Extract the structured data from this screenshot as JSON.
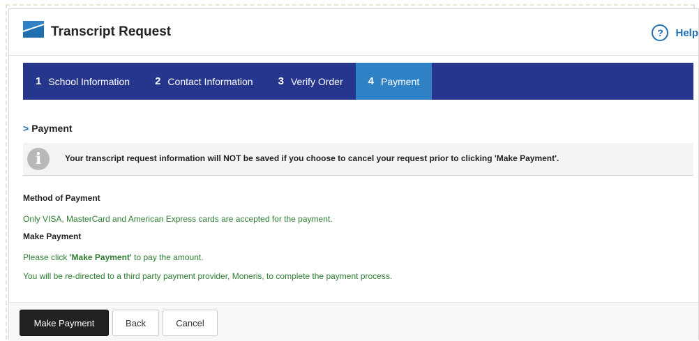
{
  "header": {
    "title": "Transcript Request",
    "help_label": "Help",
    "help_symbol": "?"
  },
  "steps": [
    {
      "number": "1",
      "label": "School Information",
      "active": false
    },
    {
      "number": "2",
      "label": "Contact Information",
      "active": false
    },
    {
      "number": "3",
      "label": "Verify Order",
      "active": false
    },
    {
      "number": "4",
      "label": "Payment",
      "active": true
    }
  ],
  "section": {
    "title": "Payment",
    "chevron": ">"
  },
  "notice": {
    "icon": "info-icon",
    "symbol": "i",
    "text": "Your transcript request information will NOT be saved if you choose to cancel your request prior to clicking 'Make Payment'."
  },
  "method": {
    "heading": "Method of Payment",
    "text": "Only VISA, MasterCard and American Express cards are accepted for the payment."
  },
  "make_payment": {
    "heading": "Make Payment",
    "line1_pre": "Please click ",
    "line1_bold": "'Make Payment'",
    "line1_post": " to pay the amount.",
    "line2": "You will be re-directed to a third party payment provider, Moneris, to complete the payment process."
  },
  "buttons": {
    "make_payment": "Make Payment",
    "back": "Back",
    "cancel": "Cancel"
  },
  "colors": {
    "nav": "#26368c",
    "active_step": "#2e82c5",
    "link_blue": "#1f6fb2",
    "green_text": "#2e7d32"
  }
}
